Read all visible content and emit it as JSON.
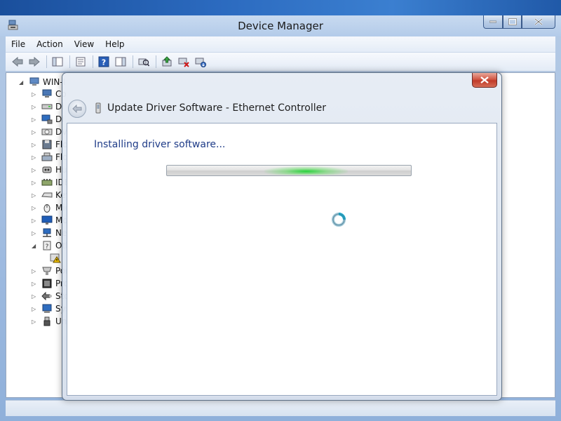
{
  "window": {
    "title": "Device Manager"
  },
  "menu": [
    "File",
    "Action",
    "View",
    "Help"
  ],
  "toolbar": {
    "icons": [
      "back-icon",
      "forward-icon",
      "show-hide-console-tree-icon",
      "properties-icon",
      "help-icon",
      "show-action-pane-icon",
      "scan-hardware-icon",
      "update-driver-icon",
      "disable-device-icon",
      "uninstall-device-icon"
    ]
  },
  "tree": {
    "root": "WIN-I",
    "nodes": [
      {
        "label": "Co",
        "icon": "computer-icon"
      },
      {
        "label": "Di",
        "icon": "disk-drive-icon"
      },
      {
        "label": "Di",
        "icon": "display-adapter-icon"
      },
      {
        "label": "DVI",
        "icon": "dvd-icon"
      },
      {
        "label": "Flo",
        "icon": "floppy-disk-icon"
      },
      {
        "label": "Flo",
        "icon": "floppy-controller-icon"
      },
      {
        "label": "Hu",
        "icon": "hid-icon"
      },
      {
        "label": "IDE",
        "icon": "ide-controller-icon"
      },
      {
        "label": "Key",
        "icon": "keyboard-icon"
      },
      {
        "label": "Mic",
        "icon": "mouse-icon"
      },
      {
        "label": "Mo",
        "icon": "monitor-icon"
      },
      {
        "label": "Net",
        "icon": "network-adapter-icon"
      },
      {
        "label": "Oth",
        "icon": "other-devices-icon"
      },
      {
        "label": "",
        "icon": "warning-device-icon"
      },
      {
        "label": "Por",
        "icon": "ports-icon"
      },
      {
        "label": "Pro",
        "icon": "processor-icon"
      },
      {
        "label": "Sto",
        "icon": "storage-controller-icon"
      },
      {
        "label": "Sys",
        "icon": "system-devices-icon"
      },
      {
        "label": "Uni",
        "icon": "usb-controller-icon"
      }
    ]
  },
  "dialog": {
    "title": "Update Driver Software - Ethernet Controller",
    "status": "Installing driver software...",
    "accent": "#1f3c88"
  }
}
